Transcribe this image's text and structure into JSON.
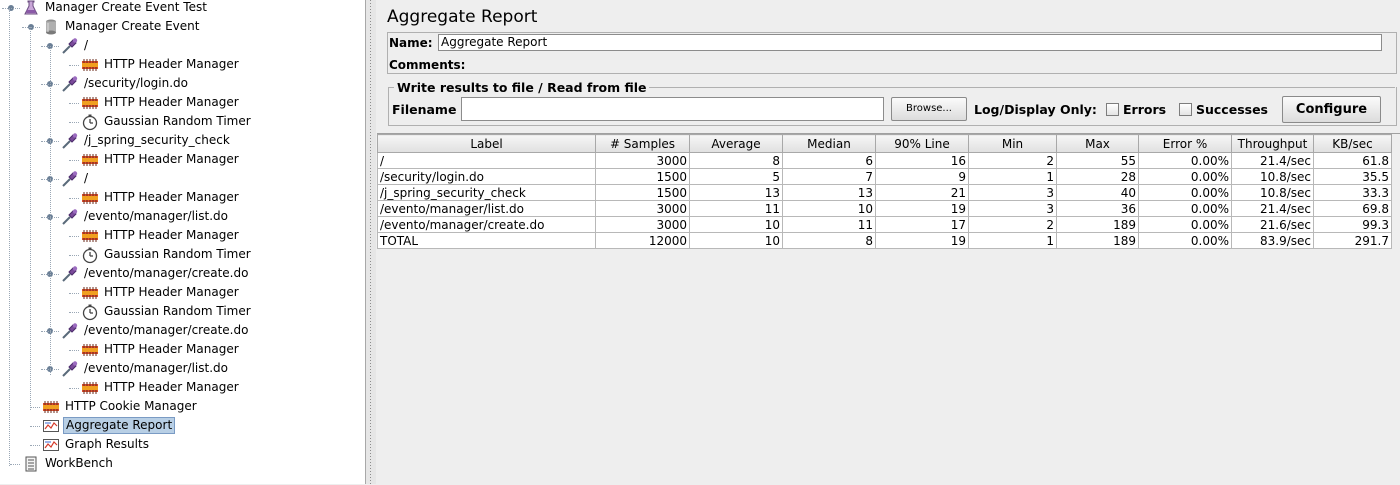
{
  "tree": {
    "nodes": [
      {
        "label": "Manager Create Event Test",
        "icon": "flask-icon"
      },
      {
        "label": "Manager Create Event",
        "icon": "thread-group-icon"
      },
      {
        "label": "/",
        "icon": "pipette-icon"
      },
      {
        "label": "HTTP Header Manager",
        "icon": "config-element-icon"
      },
      {
        "label": "/security/login.do",
        "icon": "pipette-icon"
      },
      {
        "label": "HTTP Header Manager",
        "icon": "config-element-icon"
      },
      {
        "label": "Gaussian Random Timer",
        "icon": "timer-icon"
      },
      {
        "label": "/j_spring_security_check",
        "icon": "pipette-icon"
      },
      {
        "label": "HTTP Header Manager",
        "icon": "config-element-icon"
      },
      {
        "label": "/",
        "icon": "pipette-icon"
      },
      {
        "label": "HTTP Header Manager",
        "icon": "config-element-icon"
      },
      {
        "label": "/evento/manager/list.do",
        "icon": "pipette-icon"
      },
      {
        "label": "HTTP Header Manager",
        "icon": "config-element-icon"
      },
      {
        "label": "Gaussian Random Timer",
        "icon": "timer-icon"
      },
      {
        "label": "/evento/manager/create.do",
        "icon": "pipette-icon"
      },
      {
        "label": "HTTP Header Manager",
        "icon": "config-element-icon"
      },
      {
        "label": "Gaussian Random Timer",
        "icon": "timer-icon"
      },
      {
        "label": "/evento/manager/create.do",
        "icon": "pipette-icon"
      },
      {
        "label": "HTTP Header Manager",
        "icon": "config-element-icon"
      },
      {
        "label": "/evento/manager/list.do",
        "icon": "pipette-icon"
      },
      {
        "label": "HTTP Header Manager",
        "icon": "config-element-icon"
      },
      {
        "label": "HTTP Cookie Manager",
        "icon": "config-element-icon"
      },
      {
        "label": "Aggregate Report",
        "icon": "listener-icon",
        "selected": true
      },
      {
        "label": "Graph Results",
        "icon": "listener-icon"
      },
      {
        "label": "WorkBench",
        "icon": "workbench-icon"
      }
    ]
  },
  "panel": {
    "title": "Aggregate Report",
    "name_label": "Name:",
    "name_value": "Aggregate Report",
    "comments_label": "Comments:",
    "file_section_title": "Write results to file / Read from file",
    "filename_label": "Filename",
    "filename_value": "",
    "browse_label": "Browse...",
    "log_display_label": "Log/Display Only:",
    "errors_label": "Errors",
    "successes_label": "Successes",
    "configure_label": "Configure"
  },
  "table": {
    "headers": [
      "Label",
      "# Samples",
      "Average",
      "Median",
      "90% Line",
      "Min",
      "Max",
      "Error %",
      "Throughput",
      "KB/sec"
    ],
    "rows": [
      [
        "/",
        "3000",
        "8",
        "6",
        "16",
        "2",
        "55",
        "0.00%",
        "21.4/sec",
        "61.8"
      ],
      [
        "/security/login.do",
        "1500",
        "5",
        "7",
        "9",
        "1",
        "28",
        "0.00%",
        "10.8/sec",
        "35.5"
      ],
      [
        "/j_spring_security_check",
        "1500",
        "13",
        "13",
        "21",
        "3",
        "40",
        "0.00%",
        "10.8/sec",
        "33.3"
      ],
      [
        "/evento/manager/list.do",
        "3000",
        "11",
        "10",
        "19",
        "3",
        "36",
        "0.00%",
        "21.4/sec",
        "69.8"
      ],
      [
        "/evento/manager/create.do",
        "3000",
        "10",
        "11",
        "17",
        "2",
        "189",
        "0.00%",
        "21.6/sec",
        "99.3"
      ],
      [
        "TOTAL",
        "12000",
        "10",
        "8",
        "19",
        "1",
        "189",
        "0.00%",
        "83.9/sec",
        "291.7"
      ]
    ]
  }
}
